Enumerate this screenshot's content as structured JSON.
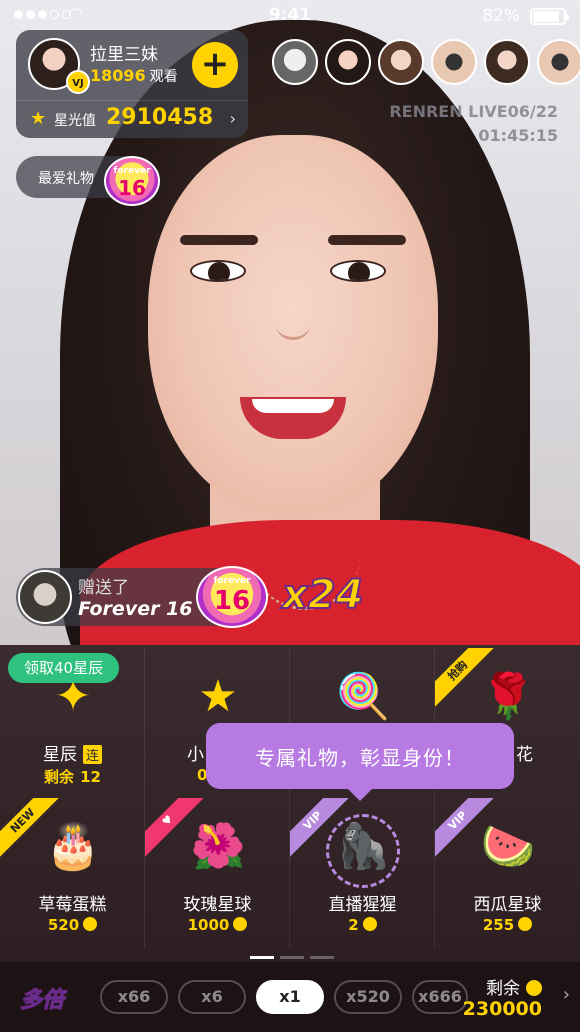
{
  "status_bar": {
    "time": "9:41",
    "battery": "82%",
    "signal_dots": 5,
    "signal_active": 3
  },
  "host": {
    "name": "拉里三妹",
    "viewers_count": "18096",
    "viewers_label": "观看",
    "vj_badge": "VJ",
    "follow_symbol": "+",
    "star_label": "星光值",
    "star_value": "2910458"
  },
  "viewer_avatars": [
    "viewer-avatar-1",
    "viewer-avatar-2",
    "viewer-avatar-3",
    "viewer-avatar-4",
    "viewer-avatar-5",
    "viewer-avatar-6"
  ],
  "watermark": {
    "brand": "RENREN LIVE06/22",
    "time": "01:45:15"
  },
  "favorite_gift": {
    "label": "最爱礼物",
    "gift_text": "forever",
    "gift_number": "16"
  },
  "gift_notification": {
    "action": "赠送了",
    "gift_name": "Forever 16",
    "combo": "x24",
    "gift_text": "forever",
    "gift_number": "16"
  },
  "panel": {
    "claim_badge": "领取40星辰",
    "tooltip": "专属礼物，彰显身份！",
    "row1": [
      {
        "name": "星辰",
        "tag": "连",
        "left_label": "剩余",
        "left_value": "12",
        "icon": "sparkle-icon"
      },
      {
        "name": "小",
        "price": "0",
        "icon": "star-icon"
      },
      {
        "name": "",
        "price": "",
        "icon": "lollipop-icon",
        "ribbon": ""
      },
      {
        "name": "花",
        "price": "",
        "icon": "rose-icon",
        "ribbon": "抢购"
      }
    ],
    "row2": [
      {
        "name": "草莓蛋糕",
        "price": "520",
        "icon": "cake-icon",
        "ribbon": "NEW"
      },
      {
        "name": "玫瑰星球",
        "price": "1000",
        "icon": "rose-planet-icon",
        "ribbon": "♥"
      },
      {
        "name": "直播猩猩",
        "price": "2",
        "icon": "gorilla-icon",
        "ribbon": "VIP"
      },
      {
        "name": "西瓜星球",
        "price": "255",
        "icon": "watermelon-planet-icon",
        "ribbon": "VIP"
      }
    ]
  },
  "bottom_bar": {
    "send_label": "多倍",
    "multipliers": [
      "x66",
      "x6",
      "x1",
      "x520",
      "x666"
    ],
    "selected": "x1",
    "balance_label": "剩余",
    "balance_value": "230000"
  },
  "colors": {
    "accent": "#ffd200",
    "vip": "#b78ae0",
    "claim": "#2fc27e",
    "panel": "#2a1c1f"
  }
}
